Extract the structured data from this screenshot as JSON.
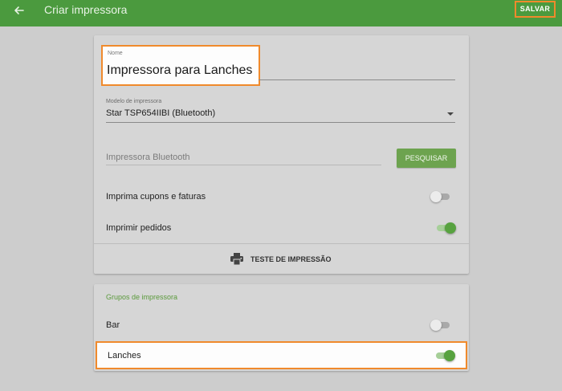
{
  "appbar": {
    "title": "Criar impressora",
    "save_label": "SALVAR",
    "color": "#4b9a3e"
  },
  "form": {
    "name_label": "Nome",
    "name_value": "Impressora para Lanches",
    "model_label": "Modelo de impressora",
    "model_value": "Star TSP654IIBI (Bluetooth)",
    "bluetooth_placeholder": "Impressora Bluetooth",
    "search_label": "PESQUISAR",
    "toggles": [
      {
        "label": "Imprima cupons e faturas",
        "on": false
      },
      {
        "label": "Imprimir pedidos",
        "on": true
      }
    ],
    "test_label": "TESTE DE IMPRESSÃO"
  },
  "groups": {
    "header": "Grupos de impressora",
    "items": [
      {
        "label": "Bar",
        "on": false
      },
      {
        "label": "Lanches",
        "on": true
      }
    ]
  },
  "icons": {
    "back": "arrow-back-icon",
    "dropdown": "dropdown-arrow-icon",
    "printer": "printer-icon"
  },
  "colors": {
    "accent": "#5b9a3c",
    "highlight": "#f08a2c",
    "toggle_on": "#57a23f"
  }
}
